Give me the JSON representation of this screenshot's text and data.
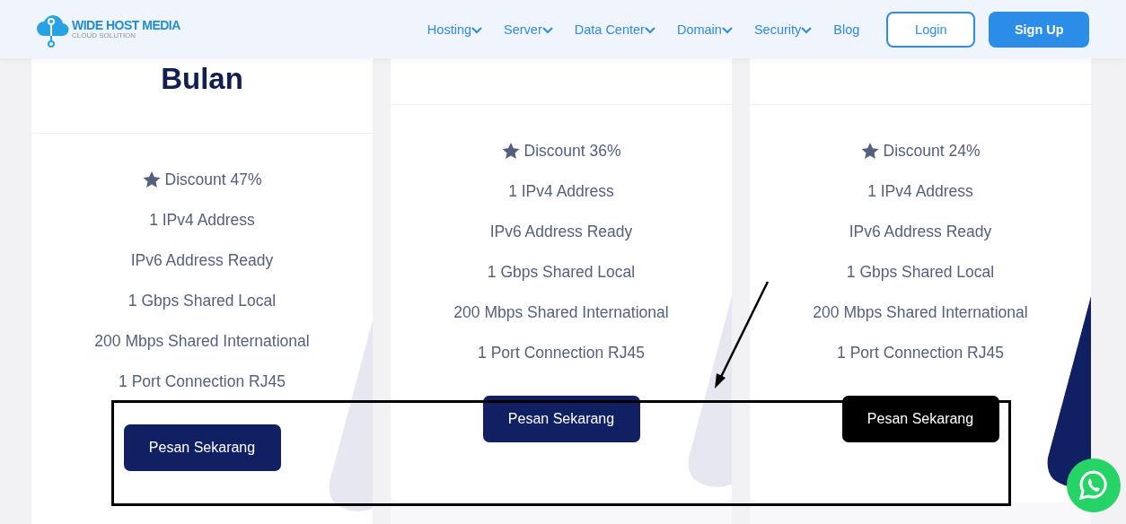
{
  "header": {
    "logo": {
      "name": "WIDE HOST MEDIA",
      "tagline": "CLOUD SOLUTION"
    },
    "nav": [
      {
        "label": "Hosting",
        "dropdown": true
      },
      {
        "label": "Server",
        "dropdown": true
      },
      {
        "label": "Data Center",
        "dropdown": true
      },
      {
        "label": "Domain",
        "dropdown": true
      },
      {
        "label": "Security",
        "dropdown": true
      },
      {
        "label": "Blog",
        "dropdown": false
      }
    ],
    "login": "Login",
    "signup": "Sign Up"
  },
  "plans": [
    {
      "title": "Bulan",
      "color": "#e6e7f0",
      "features": [
        {
          "kind": "discount",
          "label": "Discount 47%"
        },
        {
          "kind": "plain",
          "label": "1 IPv4 Address"
        },
        {
          "kind": "plain",
          "label": "IPv6 Address Ready"
        },
        {
          "kind": "plain",
          "label": "1 Gbps Shared Local"
        },
        {
          "kind": "plain",
          "label": "200 Mbps Shared International"
        },
        {
          "kind": "plain",
          "label": "1 Port Connection RJ45"
        }
      ],
      "button": {
        "label": "Pesan Sekarang",
        "hovered": false
      }
    },
    {
      "color": "#e6e7f0",
      "features": [
        {
          "kind": "discount",
          "label": "Discount 36%"
        },
        {
          "kind": "plain",
          "label": "1 IPv4 Address"
        },
        {
          "kind": "plain",
          "label": "IPv6 Address Ready"
        },
        {
          "kind": "plain",
          "label": "1 Gbps Shared Local"
        },
        {
          "kind": "plain",
          "label": "200 Mbps Shared International"
        },
        {
          "kind": "plain",
          "label": "1 Port Connection RJ45"
        }
      ],
      "button": {
        "label": "Pesan Sekarang",
        "hovered": false
      }
    },
    {
      "color": "#111f63",
      "features": [
        {
          "kind": "discount",
          "label": "Discount 24%"
        },
        {
          "kind": "plain",
          "label": "1 IPv4 Address"
        },
        {
          "kind": "plain",
          "label": "IPv6 Address Ready"
        },
        {
          "kind": "plain",
          "label": "1 Gbps Shared Local"
        },
        {
          "kind": "plain",
          "label": "200 Mbps Shared International"
        },
        {
          "kind": "plain",
          "label": "1 Port Connection RJ45"
        }
      ],
      "button": {
        "label": "Pesan Sekarang",
        "hovered": true
      }
    }
  ]
}
